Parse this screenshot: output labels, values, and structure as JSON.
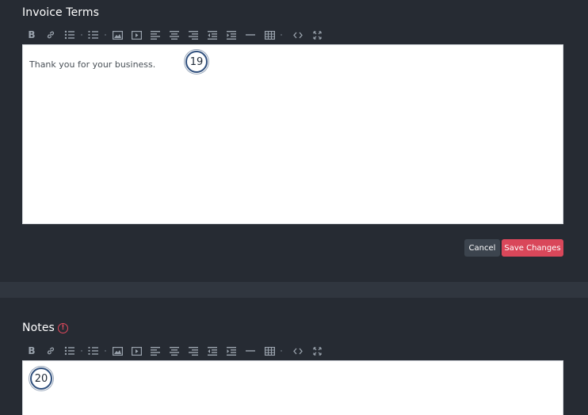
{
  "terms": {
    "title": "Invoice Terms",
    "content": "Thank you for your business.",
    "step_badge": "19",
    "cancel_label": "Cancel",
    "save_label": "Save Changes"
  },
  "notes": {
    "title": "Notes",
    "info_icon": "!",
    "step_badge": "20"
  },
  "toolbar": {
    "bold_label": "B",
    "icons": [
      "bold-icon",
      "link-icon",
      "bullet-list-icon",
      "numbered-list-icon",
      "image-icon",
      "video-icon",
      "align-left-icon",
      "align-center-icon",
      "align-right-icon",
      "outdent-icon",
      "indent-icon",
      "horizontal-rule-icon",
      "table-icon",
      "code-view-icon",
      "fullscreen-icon"
    ]
  },
  "colors": {
    "background": "#262b33",
    "divider": "#30363f",
    "save_button": "#d9475a",
    "cancel_button": "#3c444e",
    "info_icon": "#e2495d",
    "toolbar_icon": "#9aa3ad"
  }
}
